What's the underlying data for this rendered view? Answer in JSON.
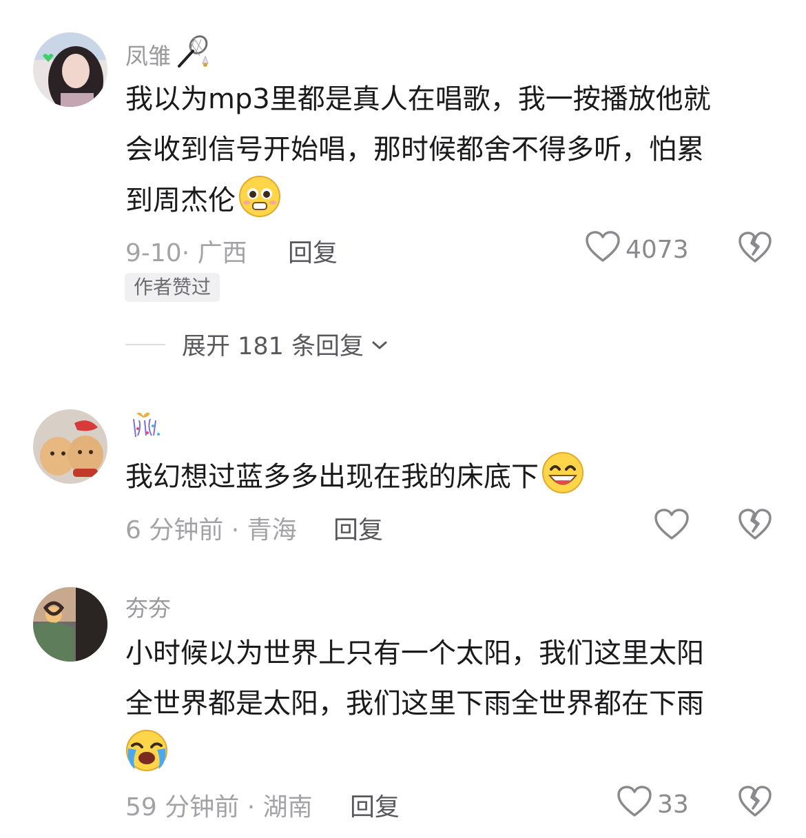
{
  "comments": [
    {
      "username": "凤雏",
      "username_icon": "badminton-racket-icon",
      "lines": [
        "我以为mp3里都是真人在唱歌，我一按播放他就",
        "会收到信号开始唱，那时候都舍不得多听，怕累",
        "到周杰伦"
      ],
      "emoji": "pleading-face-emoji",
      "meta": "9-10· 广西",
      "reply_label": "回复",
      "like_count": "4073",
      "author_liked_tag": "作者赞过",
      "expand_label": "展开 181 条回复"
    },
    {
      "username": "",
      "username_icon": "gift-confetti-icon",
      "lines": [
        "我幻想过蓝多多出现在我的床底下"
      ],
      "emoji": "grinning-face-emoji",
      "meta": "6 分钟前 · 青海",
      "reply_label": "回复",
      "like_count": ""
    },
    {
      "username": "夯夯",
      "lines": [
        "小时候以为世界上只有一个太阳，我们这里太阳",
        "全世界都是太阳，我们这里下雨全世界都在下雨"
      ],
      "emoji": "loudly-crying-face-emoji",
      "meta": "59 分钟前 · 湖南",
      "reply_label": "回复",
      "like_count": "33"
    }
  ],
  "colors": {
    "text": "#1a1a1c",
    "muted": "#a3a3a7",
    "icon": "#8a8a8e"
  }
}
